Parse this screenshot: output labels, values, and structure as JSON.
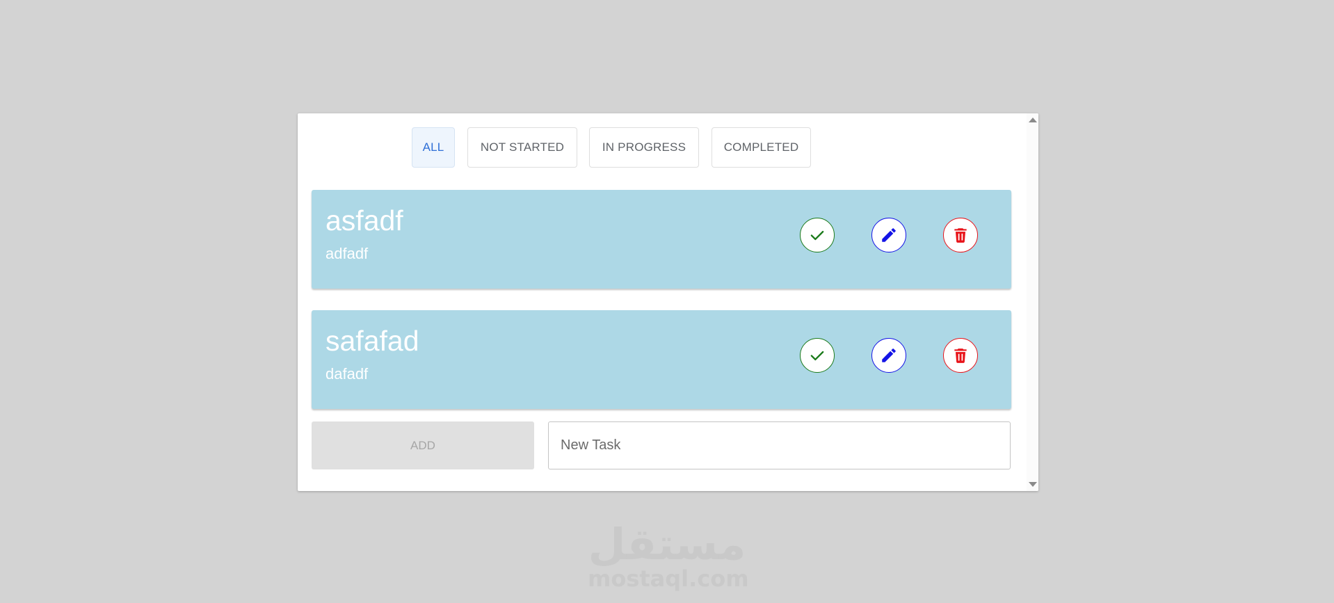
{
  "filters": [
    {
      "label": "ALL",
      "active": true
    },
    {
      "label": "NOT STARTED",
      "active": false
    },
    {
      "label": "IN PROGRESS",
      "active": false
    },
    {
      "label": "COMPLETED",
      "active": false
    }
  ],
  "tasks": [
    {
      "title": "asfadf",
      "description": "adfadf"
    },
    {
      "title": "safafad",
      "description": "dafadf"
    }
  ],
  "composer": {
    "add_label": "ADD",
    "input_placeholder": "New Task",
    "input_value": ""
  },
  "icons": {
    "complete": "check-icon",
    "edit": "pencil-icon",
    "delete": "trash-icon"
  },
  "colors": {
    "background": "#d3d3d3",
    "card": "#add8e6",
    "active_filter_text": "#2f6fd6",
    "complete": "#1a7a1a",
    "edit": "#1414e6",
    "delete": "#e8141a"
  },
  "watermark": {
    "arabic": "مستقل",
    "latin": "mostaql.com"
  }
}
